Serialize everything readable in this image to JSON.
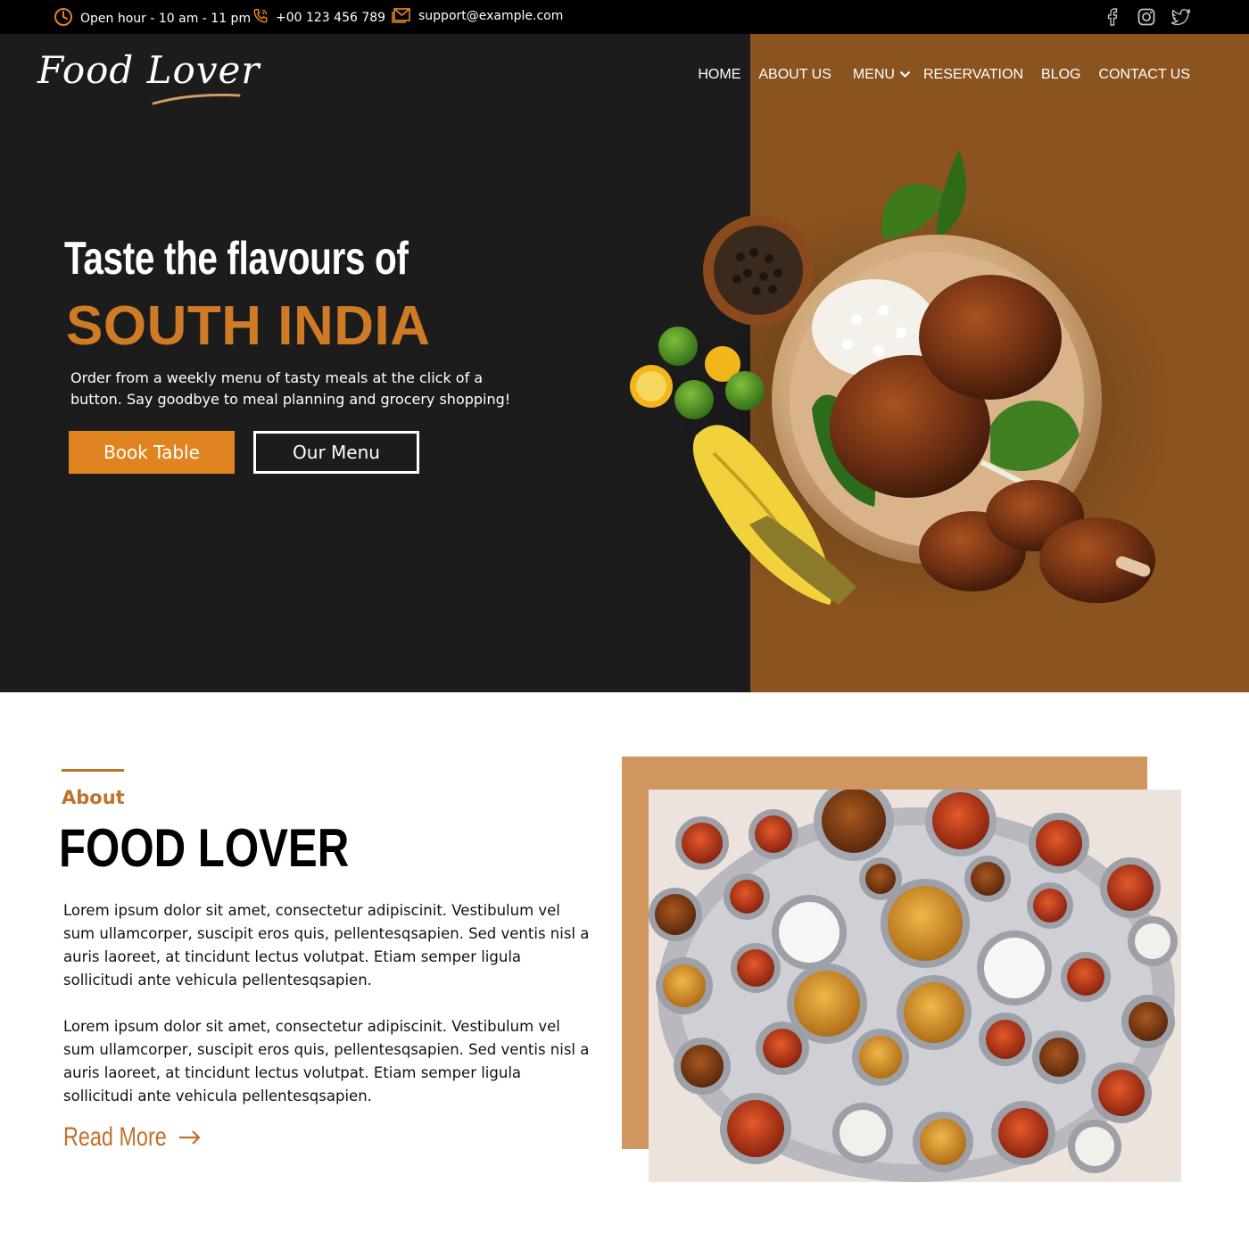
{
  "topbar": {
    "hours": "Open hour - 10 am - 11 pm",
    "phone": "+00 123 456 789",
    "email": "support@example.com",
    "social": [
      "facebook-icon",
      "instagram-icon",
      "twitter-icon"
    ]
  },
  "brand": {
    "logo_text": "Food Lover"
  },
  "nav": {
    "home": "HOME",
    "about": "ABOUT US",
    "menu": "MENU",
    "reservation": "RESERVATION",
    "blog": "BLOG",
    "contact": "CONTACT US"
  },
  "hero": {
    "title": "Taste the flavours of",
    "subtitle": "SOUTH INDIA",
    "description": "Order from a weekly menu of tasty meals at the click of a button. Say goodbye to meal planning and grocery shopping!",
    "book_label": "Book Table",
    "menu_label": "Our Menu"
  },
  "about": {
    "kicker": "About",
    "title": "FOOD LOVER",
    "paragraph1": "Lorem ipsum dolor sit amet, consectetur adipiscinit. Vestibulum vel sum ullamcorper, suscipit eros quis, pellentesqsapien. Sed ventis nisl a auris laoreet, at tincidunt lectus volutpat. Etiam semper ligula sollicitudi ante vehicula pellentesqsapien.",
    "paragraph2": "Lorem ipsum dolor sit amet, consectetur adipiscinit. Vestibulum vel sum ullamcorper, suscipit eros quis, pellentesqsapien. Sed ventis nisl a auris laoreet, at tincidunt lectus volutpat. Etiam semper ligula sollicitudi ante vehicula pellentesqsapien.",
    "read_more": "Read More"
  },
  "colors": {
    "accent": "#e08421",
    "heading_accent": "#cf7a24",
    "hero_dark": "#1c1c1c",
    "hero_brown": "#8a531f",
    "about_frame": "#cf9660"
  }
}
